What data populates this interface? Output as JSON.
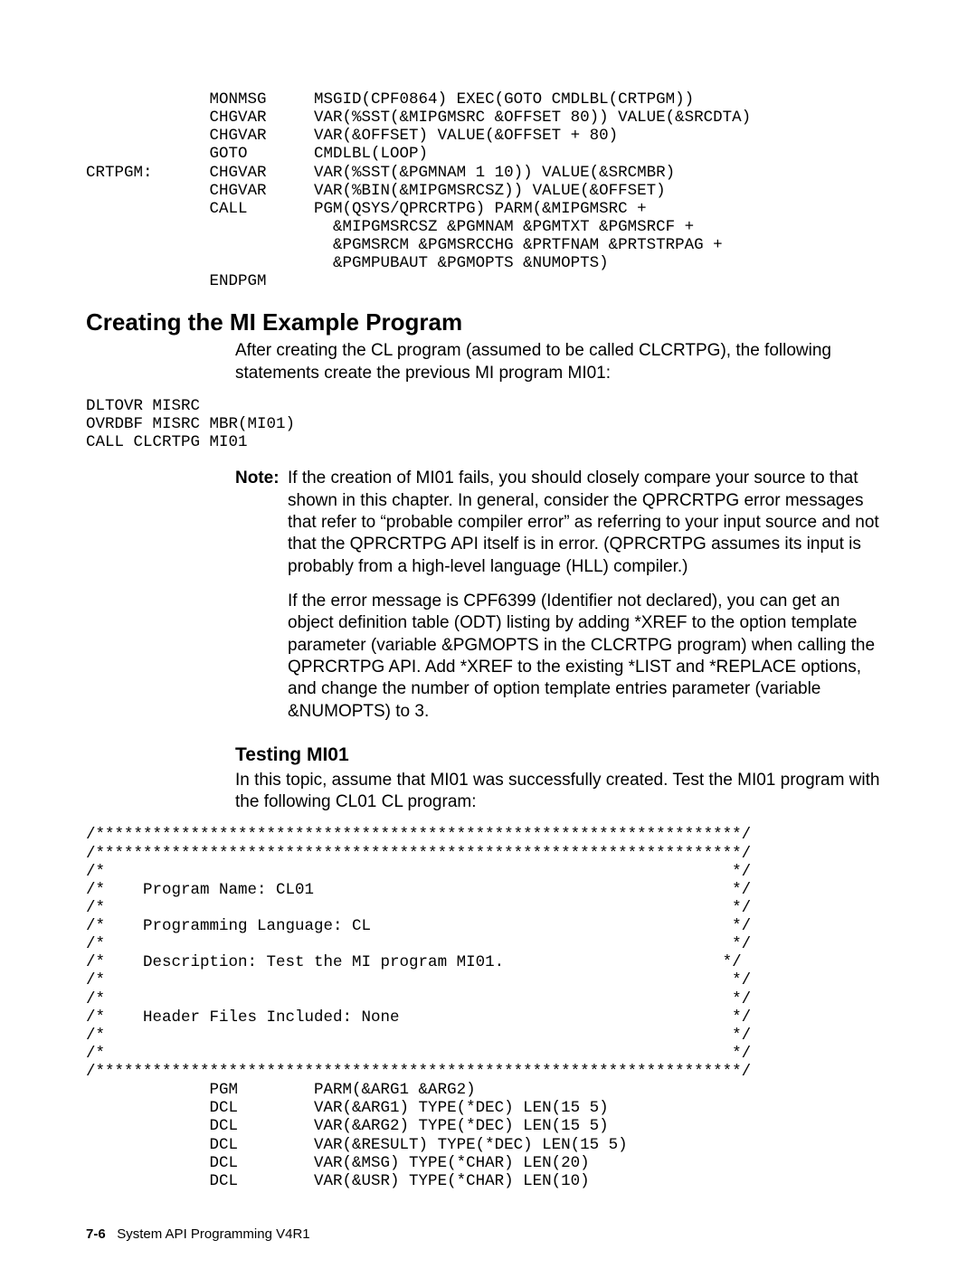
{
  "code_top": "             MONMSG     MSGID(CPF0864) EXEC(GOTO CMDLBL(CRTPGM))\n             CHGVAR     VAR(%SST(&MIPGMSRC &OFFSET 80)) VALUE(&SRCDTA)\n             CHGVAR     VAR(&OFFSET) VALUE(&OFFSET + 80)\n             GOTO       CMDLBL(LOOP)\nCRTPGM:      CHGVAR     VAR(%SST(&PGMNAM 1 10)) VALUE(&SRCMBR)\n             CHGVAR     VAR(%BIN(&MIPGMSRCSZ)) VALUE(&OFFSET)\n             CALL       PGM(QSYS/QPRCRTPG) PARM(&MIPGMSRC +\n                          &MIPGMSRCSZ &PGMNAM &PGMTXT &PGMSRCF +\n                          &PGMSRCM &PGMSRCCHG &PRTFNAM &PRTSTRPAG +\n                          &PGMPUBAUT &PGMOPTS &NUMOPTS)\n             ENDPGM",
  "heading_create": "Creating the MI Example Program",
  "para_create": "After creating the CL program (assumed to be called CLCRTPG), the following statements create the previous MI program MI01:",
  "code_mid": "DLTOVR MISRC\nOVRDBF MISRC MBR(MI01)\nCALL CLCRTPG MI01",
  "note_label": "Note:",
  "note_body1": "If the creation of MI01 fails, you should closely compare your source to that shown in this chapter.  In general, consider the QPRCRTPG error messages that refer to “probable compiler error” as referring to your input source and not that the QPRCRTPG API itself is in error.  (QPRCRTPG assumes its input is probably from a high-level language (HLL) compiler.)",
  "note_body2": "If the error message is CPF6399 (Identifier not declared), you can get an object definition table (ODT) listing by adding *XREF to the option template parameter (variable &PGMOPTS in the CLCRTPG program) when calling the QPRCRTPG API.  Add *XREF to the existing *LIST and *REPLACE options, and change the number of option template entries parameter (variable &NUMOPTS) to 3.",
  "heading_test": "Testing MI01",
  "para_test": "In this topic, assume that MI01 was successfully created.  Test the MI01 program with the following CL01 CL program:",
  "code_bottom": "/********************************************************************/\n/********************************************************************/\n/*                                                                  */\n/*    Program Name: CL01                                            */\n/*                                                                  */\n/*    Programming Language: CL                                      */\n/*                                                                  */\n/*    Description: Test the MI program MI01.                       */\n/*                                                                  */\n/*                                                                  */\n/*    Header Files Included: None                                   */\n/*                                                                  */\n/*                                                                  */\n/********************************************************************/\n             PGM        PARM(&ARG1 &ARG2)\n             DCL        VAR(&ARG1) TYPE(*DEC) LEN(15 5)\n             DCL        VAR(&ARG2) TYPE(*DEC) LEN(15 5)\n             DCL        VAR(&RESULT) TYPE(*DEC) LEN(15 5)\n             DCL        VAR(&MSG) TYPE(*CHAR) LEN(20)\n             DCL        VAR(&USR) TYPE(*CHAR) LEN(10)",
  "footer_page": "7-6",
  "footer_text": "System API Programming V4R1"
}
